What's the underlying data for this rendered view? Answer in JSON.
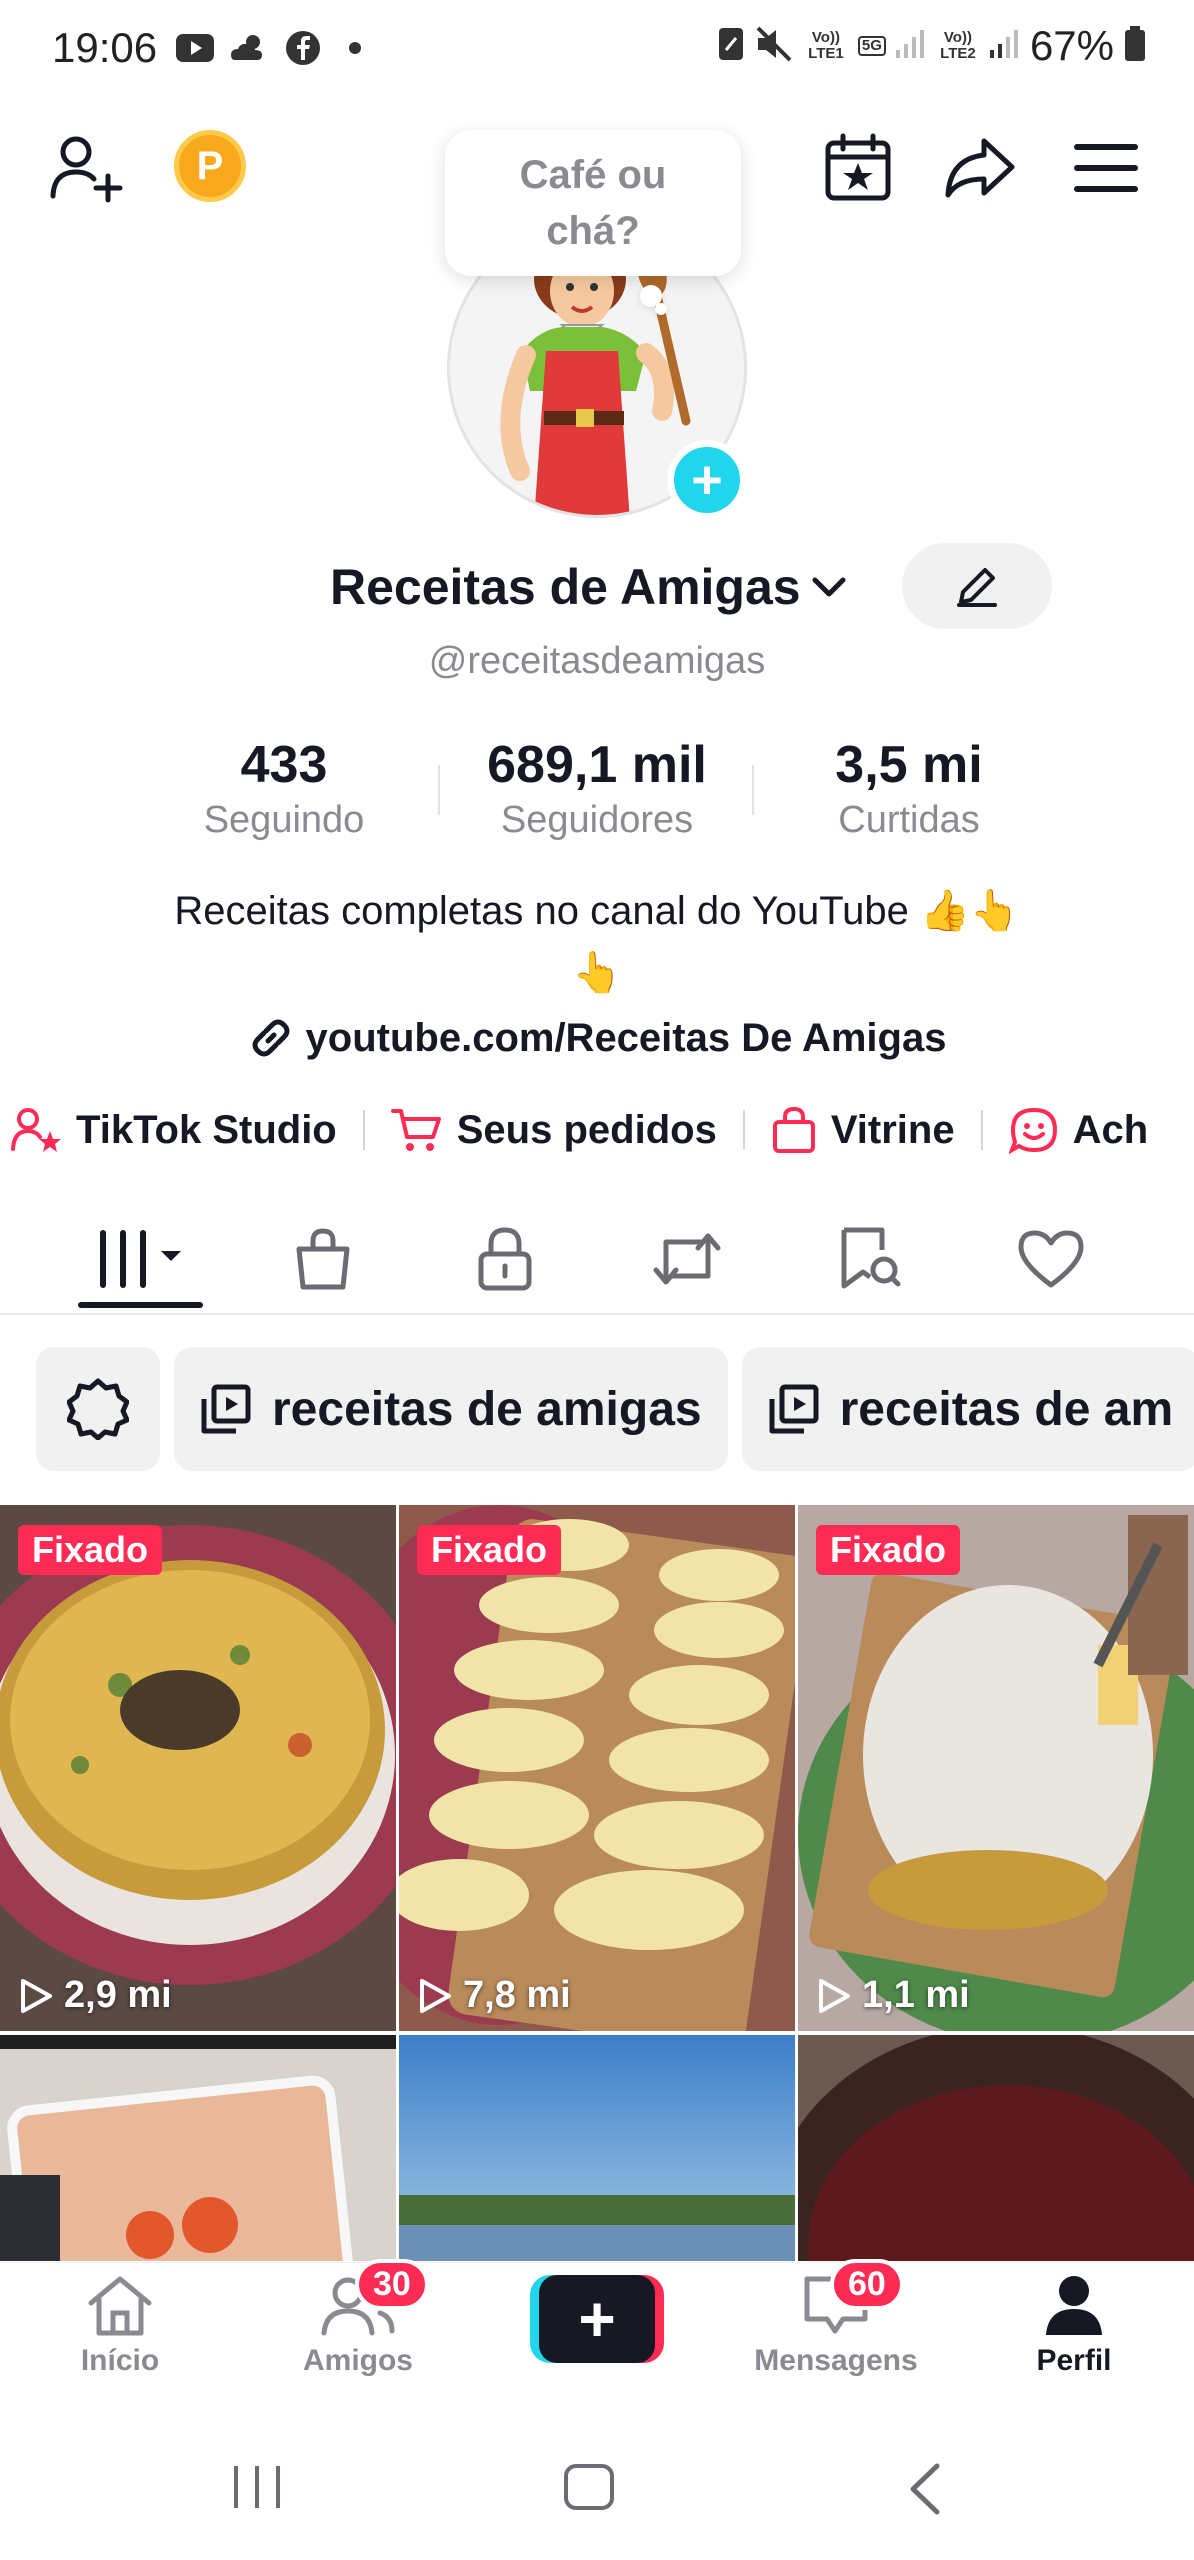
{
  "status_bar": {
    "time": "19:06",
    "left_icons": [
      "youtube-icon",
      "weather-icon",
      "facebook-icon"
    ],
    "sim1": "Vo)) LTE1",
    "network": "5G",
    "sim2": "Vo)) LTE2",
    "battery": "67%"
  },
  "top_bar": {
    "coin_letter": "P"
  },
  "profile": {
    "bubble_text": "Café ou chá?",
    "name": "Receitas de Amigas",
    "handle": "@receitasdeamigas",
    "stats": [
      {
        "value": "433",
        "label": "Seguindo"
      },
      {
        "value": "689,1 mil",
        "label": "Seguidores"
      },
      {
        "value": "3,5 mi",
        "label": "Curtidas"
      }
    ],
    "bio_line1": "Receitas completas no canal do YouTube 👍👆",
    "bio_line2": "👆",
    "link": "youtube.com/Receitas De Amigas"
  },
  "shortcuts": [
    {
      "label": "TikTok Studio",
      "icon": "tiktok-studio-icon"
    },
    {
      "label": "Seus pedidos",
      "icon": "cart-icon"
    },
    {
      "label": "Vitrine",
      "icon": "shopping-bag-icon"
    },
    {
      "label": "Ach",
      "icon": "sticker-icon"
    }
  ],
  "tabs": [
    "videos-grid-icon",
    "shop-bag-icon",
    "lock-icon",
    "repost-icon",
    "saved-icon",
    "heart-icon"
  ],
  "playlists": [
    {
      "label": "receitas de amigas"
    },
    {
      "label": "receitas de am"
    }
  ],
  "videos": [
    {
      "pinned": "Fixado",
      "views": "2,9 mi"
    },
    {
      "pinned": "Fixado",
      "views": "7,8 mi"
    },
    {
      "pinned": "Fixado",
      "views": "1,1 mi"
    }
  ],
  "bottom_nav": {
    "home": "Início",
    "friends": "Amigos",
    "friends_badge": "30",
    "create": "+",
    "messages": "Mensagens",
    "messages_badge": "60",
    "profile": "Perfil"
  },
  "colors": {
    "accent_red": "#fe2c55",
    "accent_cyan": "#20d5ec",
    "text_primary": "#161823",
    "text_secondary": "#8a8b91"
  }
}
